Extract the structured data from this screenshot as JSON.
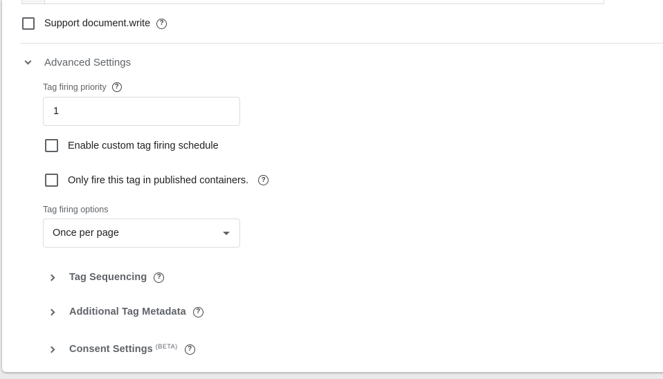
{
  "support_document_write": {
    "label": "Support document.write",
    "checked": false,
    "help_icon": "help-circle-icon"
  },
  "advanced_settings": {
    "title": "Advanced Settings",
    "expanded": true,
    "tag_firing_priority": {
      "label": "Tag firing priority",
      "value": "1"
    },
    "enable_custom_schedule": {
      "label": "Enable custom tag firing schedule",
      "checked": false
    },
    "only_fire_published": {
      "label": "Only fire this tag in published containers.",
      "checked": false
    },
    "tag_firing_options": {
      "label": "Tag firing options",
      "selected": "Once per page"
    },
    "sections": [
      {
        "label": "Tag Sequencing",
        "badge": ""
      },
      {
        "label": "Additional Tag Metadata",
        "badge": ""
      },
      {
        "label": "Consent Settings",
        "badge": "(BETA)"
      }
    ]
  },
  "colors": {
    "text_primary": "#202124",
    "text_secondary": "#5f6368",
    "border": "#dadce0"
  }
}
